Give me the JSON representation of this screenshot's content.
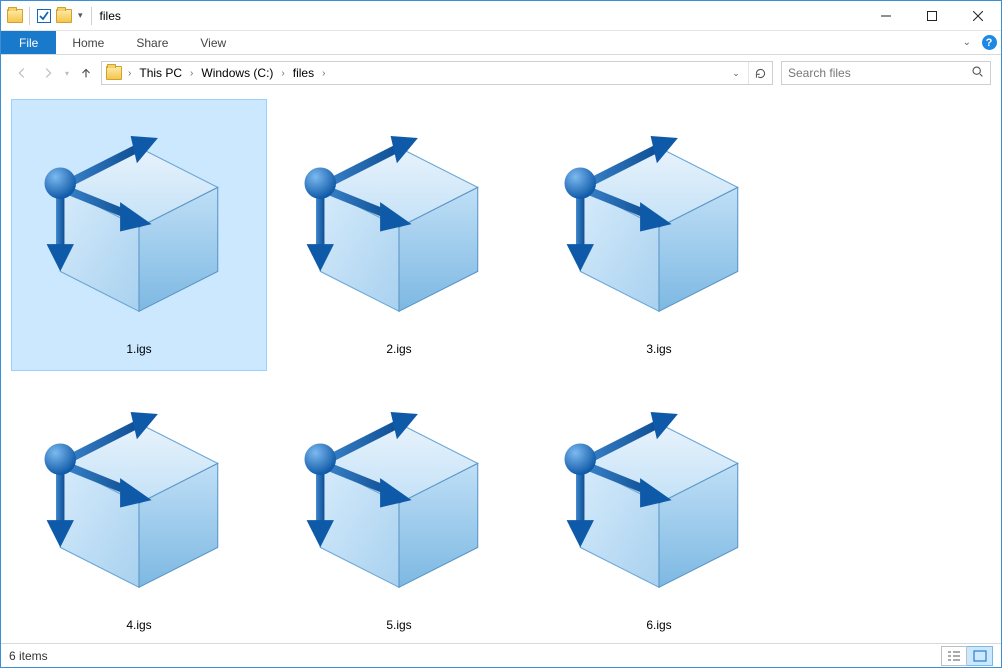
{
  "window": {
    "title": "files"
  },
  "ribbon": {
    "file_label": "File",
    "tabs": [
      {
        "label": "Home"
      },
      {
        "label": "Share"
      },
      {
        "label": "View"
      }
    ]
  },
  "breadcrumb": {
    "items": [
      {
        "label": "This PC"
      },
      {
        "label": "Windows (C:)"
      },
      {
        "label": "files"
      }
    ]
  },
  "search": {
    "placeholder": "Search files"
  },
  "files": [
    {
      "name": "1.igs",
      "selected": true
    },
    {
      "name": "2.igs",
      "selected": false
    },
    {
      "name": "3.igs",
      "selected": false
    },
    {
      "name": "4.igs",
      "selected": false
    },
    {
      "name": "5.igs",
      "selected": false
    },
    {
      "name": "6.igs",
      "selected": false
    }
  ],
  "status": {
    "item_count_label": "6 items"
  }
}
